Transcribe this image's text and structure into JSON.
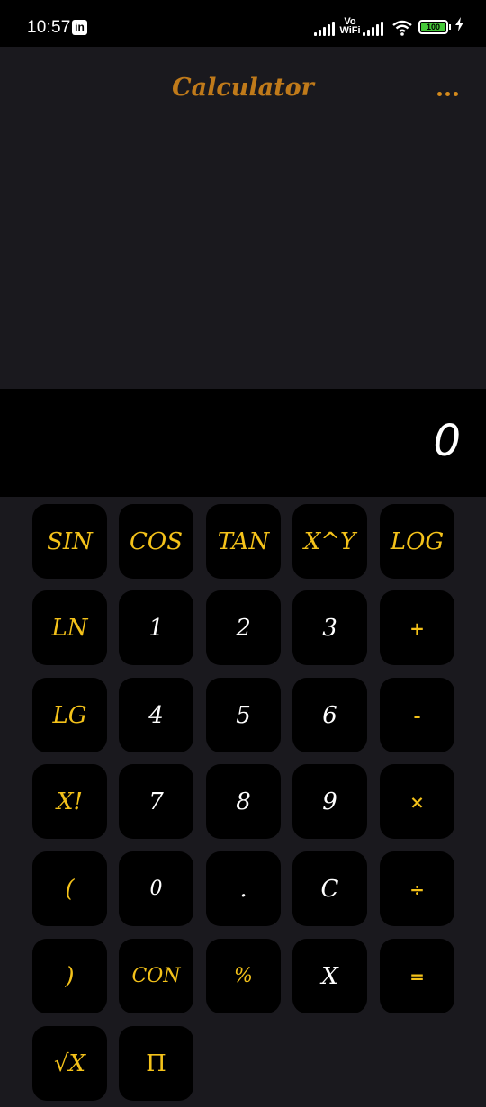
{
  "status_bar": {
    "time": "10:57",
    "app_icon": "in",
    "network_label": "Vo WiFi",
    "battery_level": "100",
    "battery_color": "#46c93a"
  },
  "header": {
    "title": "Calculator",
    "title_color": "#c07a1a",
    "menu_icon": "more-dots-icon"
  },
  "display": {
    "value": "0"
  },
  "keypad": {
    "rows": [
      [
        "SIN",
        "COS",
        "TAN",
        "X^Y",
        "LOG"
      ],
      [
        "LN",
        "1",
        "2",
        "3",
        "+"
      ],
      [
        "LG",
        "4",
        "5",
        "6",
        "-"
      ],
      [
        "X!",
        "7",
        "8",
        "9",
        "×"
      ],
      [
        "(",
        "0",
        ".",
        "C",
        "÷"
      ],
      [
        ")",
        "CON",
        "%",
        "X",
        "="
      ],
      [
        "√X",
        "Π"
      ]
    ],
    "accent_color": "#f4c21a"
  }
}
